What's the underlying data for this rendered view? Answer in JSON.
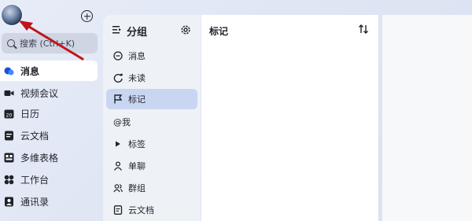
{
  "search": {
    "placeholder": "搜索 (Ctrl+K)"
  },
  "nav": {
    "items": [
      {
        "label": "消息",
        "icon": "message-bubble-icon",
        "active": true
      },
      {
        "label": "视频会议",
        "icon": "video-camera-icon",
        "active": false
      },
      {
        "label": "日历",
        "icon": "calendar-icon",
        "active": false
      },
      {
        "label": "云文档",
        "icon": "cloud-doc-icon",
        "active": false
      },
      {
        "label": "多维表格",
        "icon": "table-grid-icon",
        "active": false
      },
      {
        "label": "工作台",
        "icon": "workbench-icon",
        "active": false
      },
      {
        "label": "通讯录",
        "icon": "contacts-icon",
        "active": false
      }
    ]
  },
  "group_panel": {
    "title": "分组",
    "items": [
      {
        "label": "消息",
        "icon": "chat-icon",
        "active": false
      },
      {
        "label": "未读",
        "icon": "unread-icon",
        "active": false
      },
      {
        "label": "标记",
        "icon": "flag-icon",
        "active": true
      },
      {
        "label": "@我",
        "icon": "at-icon",
        "active": false
      },
      {
        "label": "标签",
        "icon": "triangle-tag-icon",
        "active": false
      },
      {
        "label": "单聊",
        "icon": "person-icon",
        "active": false
      },
      {
        "label": "群组",
        "icon": "group-icon",
        "active": false
      },
      {
        "label": "云文档",
        "icon": "document-icon",
        "active": false
      }
    ]
  },
  "content": {
    "title": "标记"
  },
  "colors": {
    "accent": "#c9d6f2",
    "annotation_arrow": "#c0141a",
    "background": "#e3e8f5"
  }
}
